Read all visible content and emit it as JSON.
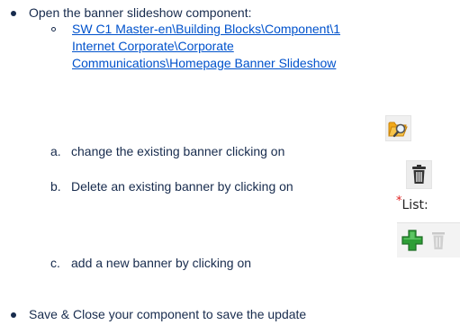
{
  "steps": {
    "open_label": "Open the banner slideshow component:",
    "path_link": {
      "line1": "SW C1 Master-en\\Building Blocks\\Component\\1",
      "line2": "Internet Corporate\\Corporate",
      "line3": "Communications\\Homepage Banner Slideshow"
    },
    "substeps": [
      {
        "marker": "a.",
        "text": "change the existing banner clicking on",
        "icon": "folder-search-icon"
      },
      {
        "marker": "b.",
        "text": "Delete an existing banner by clicking on",
        "icon": "trash-icon"
      },
      {
        "marker": "c.",
        "text": "add a new banner by clicking on",
        "icon": "add-plus-icon"
      }
    ],
    "list_widget": {
      "required_mark": "*",
      "label": "List:"
    },
    "save_label": "Save & Close your component to save the update"
  },
  "colors": {
    "link": "#0052cc",
    "text": "#172b4d",
    "plus": "#2e9e36"
  }
}
